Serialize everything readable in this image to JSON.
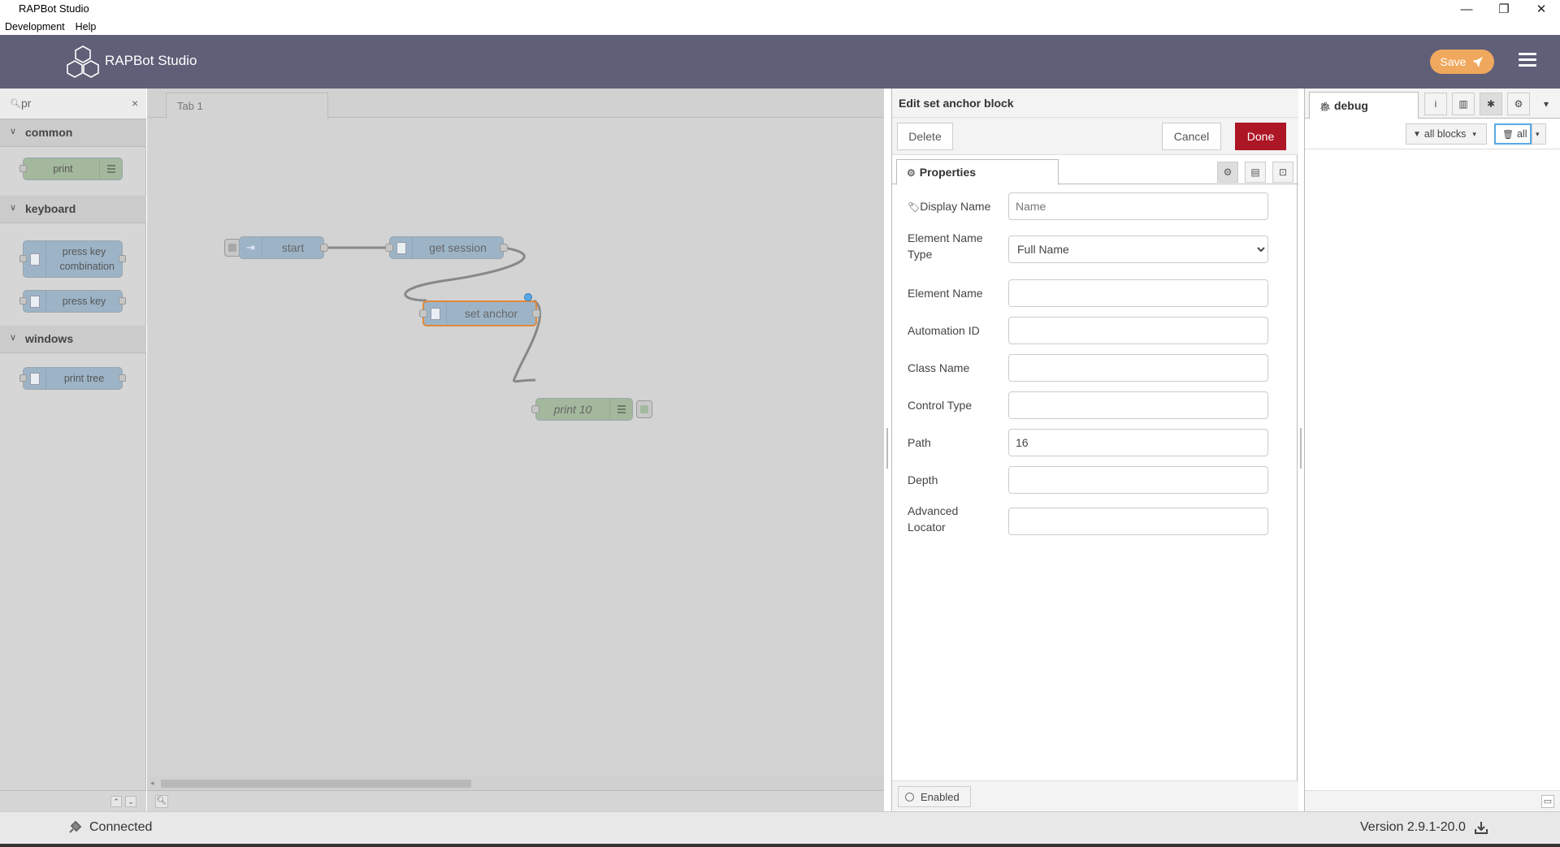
{
  "window": {
    "title": "RAPBot Studio",
    "controls": [
      "—",
      "❐",
      "✕"
    ]
  },
  "menubar": {
    "items": [
      "Development",
      "Help"
    ]
  },
  "header": {
    "brand": "RAPBot Studio",
    "save_label": "Save",
    "colors": {
      "bar": "#5f5f78",
      "save": "#f0a85e"
    }
  },
  "palette": {
    "search_value": "pr",
    "categories": [
      {
        "label": "common",
        "nodes": [
          "print"
        ]
      },
      {
        "label": "keyboard",
        "nodes": [
          "press key combination",
          "press key"
        ]
      },
      {
        "label": "windows",
        "nodes": [
          "print tree"
        ]
      }
    ]
  },
  "workspace": {
    "tab_label": "Tab 1",
    "nodes": {
      "start": "start",
      "get_session": "get session",
      "set_anchor": "set anchor",
      "print": "print 10"
    }
  },
  "editor": {
    "title": "Edit set anchor block",
    "delete_label": "Delete",
    "cancel_label": "Cancel",
    "done_label": "Done",
    "properties_tab": "Properties",
    "fields": {
      "display_name": {
        "label": "Display Name",
        "placeholder": "Name",
        "value": ""
      },
      "element_name_type": {
        "label": "Element Name Type",
        "value": "Full Name"
      },
      "element_name": {
        "label": "Element Name",
        "value": ""
      },
      "automation_id": {
        "label": "Automation ID",
        "value": ""
      },
      "class_name": {
        "label": "Class Name",
        "value": ""
      },
      "control_type": {
        "label": "Control Type",
        "value": ""
      },
      "path": {
        "label": "Path",
        "value": "16"
      },
      "depth": {
        "label": "Depth",
        "value": ""
      },
      "advanced_locator": {
        "label": "Advanced Locator",
        "value": ""
      }
    },
    "enabled_label": "Enabled"
  },
  "sidebar": {
    "tab_label": "debug",
    "filter_label": "all blocks",
    "clear_label": "all"
  },
  "statusbar": {
    "connection": "Connected",
    "version": "Version 2.9.1-20.0"
  }
}
